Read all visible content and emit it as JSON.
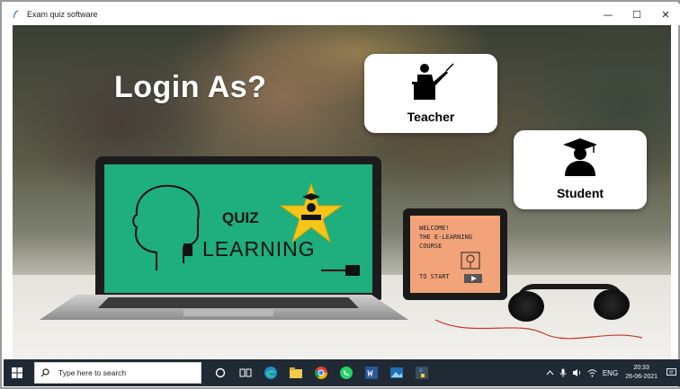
{
  "window": {
    "title": "Exam quiz software",
    "controls": {
      "minimize": "—",
      "maximize": "☐",
      "close": "✕"
    }
  },
  "main": {
    "heading": "Login As?",
    "roles": [
      {
        "label": "Teacher",
        "icon": "teacher-icon"
      },
      {
        "label": "Student",
        "icon": "student-icon"
      }
    ]
  },
  "laptop_screen": {
    "logo_word_top": "QUIZ",
    "logo_word_bottom": "LEARNING"
  },
  "tablet": {
    "lines": [
      "WELCOME!",
      "THE E-LEARNING",
      "COURSE",
      "TO START"
    ]
  },
  "taskbar": {
    "search_placeholder": "Type here to search",
    "language": "ENG",
    "time": "20:33",
    "date": "26-06-2021",
    "pinned_apps": [
      "task-view-icon",
      "edge-icon",
      "file-explorer-icon",
      "chrome-icon",
      "whatsapp-icon",
      "word-icon",
      "photos-icon",
      "python-icon"
    ]
  },
  "colors": {
    "screen_green": "#1fae7e",
    "tablet_orange": "#f2a37a",
    "taskbar": "#1f2a35",
    "card": "#ffffff",
    "star": "#f5c518"
  }
}
